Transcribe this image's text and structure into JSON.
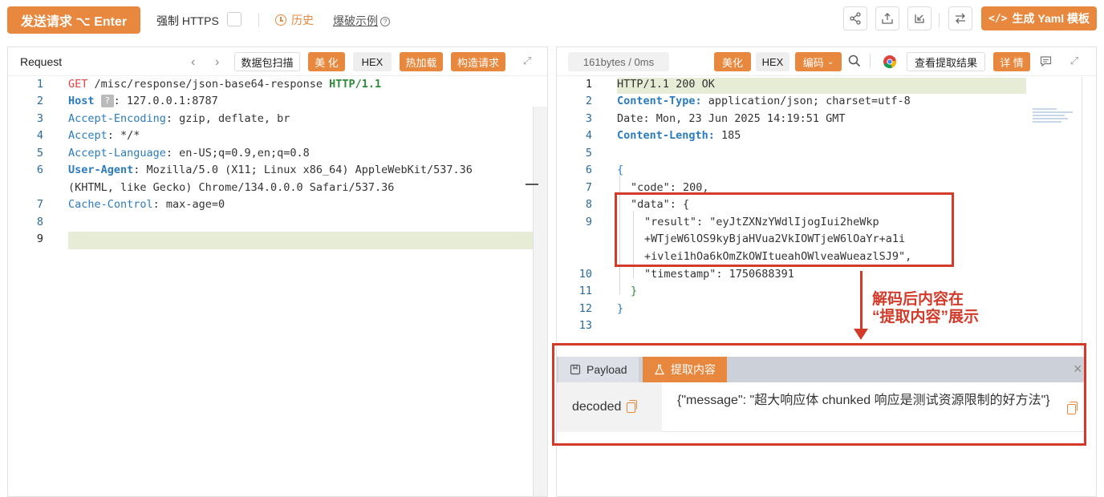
{
  "toolbar": {
    "send_label": "发送请求 ⌥ Enter",
    "https_label": "强制 HTTPS",
    "history_label": "历史",
    "blast_label": "爆破示例",
    "yaml_label": "生成 Yaml 模板",
    "icons": [
      "share-icon",
      "upload-icon",
      "import-icon",
      "swap-icon"
    ]
  },
  "request": {
    "title": "Request",
    "buttons": {
      "scan": "数据包扫描",
      "beautify": "美 化",
      "hex": "HEX",
      "hotload": "热加载",
      "construct": "构造请求"
    },
    "lines": [
      {
        "n": "1"
      },
      {
        "n": "2"
      },
      {
        "n": "3"
      },
      {
        "n": "4"
      },
      {
        "n": "5"
      },
      {
        "n": "6"
      },
      {
        "n": "7"
      },
      {
        "n": "8"
      },
      {
        "n": "9"
      }
    ],
    "method": "GET",
    "path": "/misc/response/json-base64-response",
    "proto": "HTTP/1.1",
    "host_key": "Host",
    "host_badge": "?",
    "host_val": ": 127.0.0.1:8787",
    "accept_enc_key": "Accept-Encoding",
    "accept_enc_val": ": gzip, deflate, br",
    "accept_key": "Accept",
    "accept_val": ": */*",
    "accept_lang_key": "Accept-Language",
    "accept_lang_val": ": en-US;q=0.9,en;q=0.8",
    "ua_key": "User-Agent",
    "ua_val1": ": Mozilla/5.0 (X11; Linux x86_64) AppleWebKit/537.36",
    "ua_val2": "(KHTML, like Gecko) Chrome/134.0.0.0 Safari/537.36",
    "cc_key": "Cache-Control",
    "cc_val": ": max-age=0"
  },
  "response": {
    "size_label": "161bytes / 0ms",
    "buttons": {
      "beautify": "美化",
      "hex": "HEX",
      "encode": "编码",
      "view_extract": "查看提取结果",
      "detail": "详 情"
    },
    "status_line": "HTTP/1.1 200 OK",
    "ct_key": "Content-Type:",
    "ct_val": " application/json; charset=utf-8",
    "date_line": "Date: Mon, 23 Jun 2025 14:19:51 GMT",
    "cl_key": "Content-Length:",
    "cl_val": " 185",
    "brace_open": "{",
    "code_line": "\"code\": 200,",
    "data_line": "\"data\": {",
    "result_line1": "\"result\": \"eyJtZXNzYWdlIjogIui2heWkp",
    "result_line2": "+WTjeW6lOS9kyBjaHVua2VkIOWTjeW6lOaYr+a1i",
    "result_line3": "+ivlei1hOa6kOmZkOWItueahOWlveaWueazlSJ9\",",
    "ts_line": "\"timestamp\": 1750688391",
    "inner_close": "}",
    "brace_close": "}",
    "line_numbers": [
      "1",
      "2",
      "3",
      "4",
      "5",
      "6",
      "7",
      "8",
      "9",
      "10",
      "11",
      "12",
      "13"
    ]
  },
  "annotation": {
    "line1": "解码后内容在",
    "line2": "“提取内容”展示"
  },
  "extract": {
    "tab_payload": "Payload",
    "tab_extract": "提取内容",
    "key": "decoded",
    "value": "{\"message\": \"超大响应体 chunked 响应是测试资源限制的好方法\"}"
  },
  "colors": {
    "accent": "#e8883e",
    "annotation": "#d23a2a"
  }
}
